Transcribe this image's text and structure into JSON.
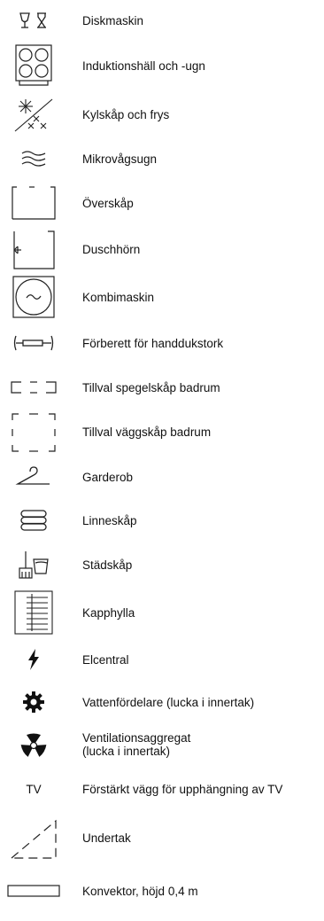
{
  "legend": [
    {
      "id": "diskmaskin",
      "icon": "dishwasher-icon",
      "label": "Diskmaskin"
    },
    {
      "id": "induktion",
      "icon": "induction-hob-oven-icon",
      "label": "Induktionshäll och -ugn"
    },
    {
      "id": "kylfrys",
      "icon": "fridge-freezer-icon",
      "label": "Kylskåp och frys"
    },
    {
      "id": "mikro",
      "icon": "microwave-icon",
      "label": "Mikrovågsugn"
    },
    {
      "id": "overskap",
      "icon": "wall-cabinet-icon",
      "label": "Överskåp"
    },
    {
      "id": "duschhorn",
      "icon": "shower-corner-icon",
      "label": "Duschhörn"
    },
    {
      "id": "kombimaskin",
      "icon": "washer-dryer-icon",
      "label": "Kombimaskin"
    },
    {
      "id": "handdukstork",
      "icon": "towel-rail-icon",
      "label": "Förberett för handdukstork"
    },
    {
      "id": "spegelskap",
      "icon": "mirror-cabinet-icon",
      "label": "Tillval spegelskåp badrum"
    },
    {
      "id": "vaggskap",
      "icon": "bathroom-wall-cabinet-icon",
      "label": "Tillval väggskåp badrum"
    },
    {
      "id": "garderob",
      "icon": "hanger-icon",
      "label": "Garderob"
    },
    {
      "id": "linneskap",
      "icon": "linen-cabinet-icon",
      "label": "Linneskåp"
    },
    {
      "id": "stadskap",
      "icon": "cleaning-cabinet-icon",
      "label": "Städskåp"
    },
    {
      "id": "kapphylla",
      "icon": "coat-rack-icon",
      "label": "Kapphylla"
    },
    {
      "id": "elcentral",
      "icon": "lightning-icon",
      "label": "Elcentral"
    },
    {
      "id": "vattenfordelare",
      "icon": "gear-icon",
      "label": "Vattenfördelare (lucka i innertak)"
    },
    {
      "id": "ventilation",
      "icon": "fan-icon",
      "label": "Ventilationsaggregat\n(lucka i innertak)"
    },
    {
      "id": "tv",
      "icon": "tv-text-symbol",
      "symbol_text": "TV",
      "label": "Förstärkt vägg för upphängning av TV"
    },
    {
      "id": "undertak",
      "icon": "suspended-ceiling-icon",
      "label": "Undertak"
    },
    {
      "id": "konvektor",
      "icon": "convector-icon",
      "label": "Konvektor, höjd 0,4 m"
    }
  ]
}
